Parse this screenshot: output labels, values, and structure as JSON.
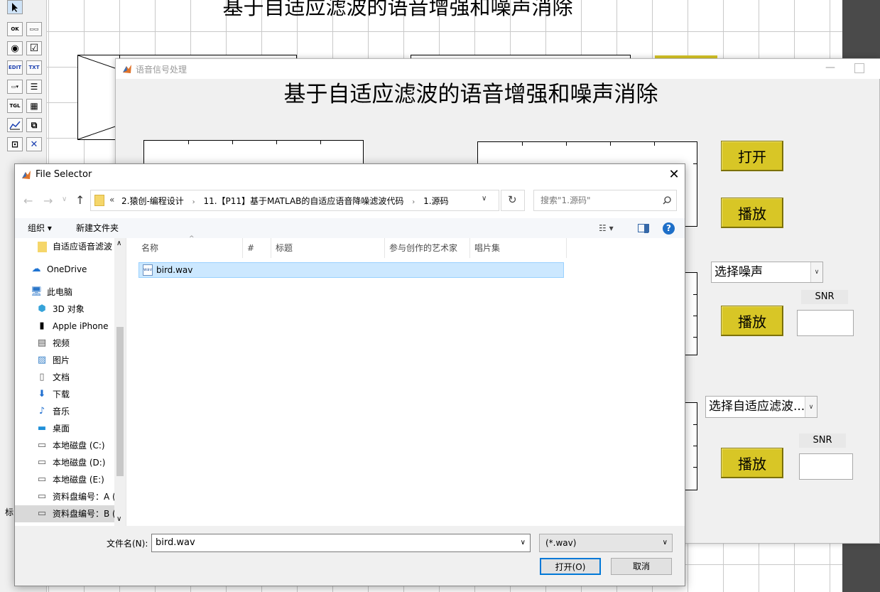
{
  "guide": {
    "title": "基于自适应滤波的语音增强和噪声消除",
    "status_char": "标"
  },
  "palette": {
    "items": [
      {
        "name": "select-tool-icon",
        "glyph": "➘"
      },
      {
        "name": "push-button-tool",
        "glyph": "OK"
      },
      {
        "name": "slider-tool",
        "glyph": "▭"
      },
      {
        "name": "radio-button-tool",
        "glyph": "◉"
      },
      {
        "name": "checkbox-tool",
        "glyph": "☑"
      },
      {
        "name": "edit-text-tool",
        "glyph": "EDIT"
      },
      {
        "name": "static-text-tool",
        "glyph": "TXT"
      },
      {
        "name": "popup-menu-tool",
        "glyph": "▭▾"
      },
      {
        "name": "listbox-tool",
        "glyph": "☰"
      },
      {
        "name": "toggle-button-tool",
        "glyph": "TGL"
      },
      {
        "name": "table-tool",
        "glyph": "▦"
      },
      {
        "name": "axes-tool",
        "glyph": "📈"
      },
      {
        "name": "panel-tool",
        "glyph": "⧉"
      },
      {
        "name": "button-group-tool",
        "glyph": "⊡"
      },
      {
        "name": "activex-tool",
        "glyph": "✕"
      }
    ]
  },
  "figure": {
    "window_title": "语音信号处理",
    "heading": "基于自适应滤波的语音增强和噪声消除",
    "open_button": "打开",
    "play_button_1": "播放",
    "play_button_2": "播放",
    "play_button_3": "播放",
    "noise_popup": "选择噪声",
    "filter_popup": "选择自适应滤波...",
    "snr_label_1": "SNR",
    "snr_label_2": "SNR"
  },
  "dialog": {
    "title": "File Selector",
    "breadcrumb": {
      "prefix": "«",
      "parts": [
        "2.猿创-编程设计",
        "11.【P11】基于MATLAB的自适应语音降噪滤波代码",
        "1.源码"
      ]
    },
    "search_placeholder": "搜索\"1.源码\"",
    "toolbar": {
      "organize": "组织 ▾",
      "new_folder": "新建文件夹"
    },
    "nav_items": [
      {
        "label": "自适应语音滤波",
        "icon": "folder-icon"
      },
      {
        "label": "OneDrive",
        "icon": "cloud-icon"
      },
      {
        "label": "此电脑",
        "icon": "computer-icon"
      },
      {
        "label": "3D 对象",
        "icon": "cube-icon"
      },
      {
        "label": "Apple iPhone",
        "icon": "phone-icon"
      },
      {
        "label": "视频",
        "icon": "video-icon"
      },
      {
        "label": "图片",
        "icon": "picture-icon"
      },
      {
        "label": "文档",
        "icon": "document-icon"
      },
      {
        "label": "下载",
        "icon": "download-icon"
      },
      {
        "label": "音乐",
        "icon": "music-icon"
      },
      {
        "label": "桌面",
        "icon": "desktop-icon"
      },
      {
        "label": "本地磁盘 (C:)",
        "icon": "drive-c-icon"
      },
      {
        "label": "本地磁盘 (D:)",
        "icon": "drive-icon"
      },
      {
        "label": "本地磁盘 (E:)",
        "icon": "drive-icon"
      },
      {
        "label": "资料盘编号：A (",
        "icon": "drive-icon"
      },
      {
        "label": "资料盘编号：B (",
        "icon": "drive-icon"
      }
    ],
    "columns": [
      "名称",
      "#",
      "标题",
      "参与创作的艺术家",
      "唱片集"
    ],
    "files": [
      {
        "name": "bird.wav"
      }
    ],
    "filename_label": "文件名(N):",
    "filename_value": "bird.wav",
    "filter_value": "(*.wav)",
    "open_label": "打开(O)",
    "cancel_label": "取消"
  }
}
